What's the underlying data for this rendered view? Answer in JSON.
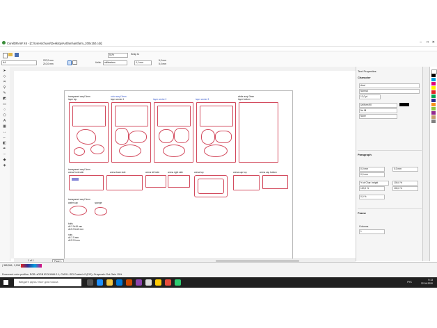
{
  "window": {
    "title": "CorelDRAW X6 - [C:\\Users\\chuvs\\Desktop\\Antfarm\\antfarm_200x150.cdr]"
  },
  "toolbar": {
    "zoom": "51%",
    "snap_to": "Snap to"
  },
  "propertybar": {
    "page_size": "A4",
    "width": "297,0 mm",
    "height": "210,0 mm",
    "units_label": "Units:",
    "units": "millimeters",
    "nudge": "0,1 mm",
    "dup_x": "5,0 mm",
    "dup_y": "5,0 mm"
  },
  "document": {
    "sheet1": {
      "label": "transparent acryl 3mm",
      "sub": "layer top"
    },
    "sheet2": {
      "label": "color acryl 3mm",
      "sub": "layer center 1"
    },
    "sheet3": {
      "label": "layer center 2"
    },
    "sheet4": {
      "label": "layer center 3"
    },
    "sheet5": {
      "label": "white acryl 3mm",
      "sub": "layer bottom"
    },
    "row2": {
      "label": "transparent acryl 3mm",
      "arena_front": "arena front side",
      "arena_back": "arena back side",
      "arena_left": "arena left side",
      "arena_right": "arena right side",
      "arena_top": "arena top",
      "arena_cap_top": "arena cap top",
      "arena_cap_bottom": "arena cap bottom"
    },
    "row3": {
      "label": "transparent acryl 3mm",
      "water_cap": "water cap",
      "sponge": "sponge"
    },
    "bolts": {
      "title": "bolts",
      "l1": "d4        2.5x16 mm",
      "l2": "d12       2.5x10 mm"
    },
    "nuts": {
      "title": "nuts",
      "l1": "d4        2.5 mm",
      "l2": "d12       2.5 mm"
    }
  },
  "pagenav": {
    "counter": "1 of 1",
    "tab": "Page 1"
  },
  "docker": {
    "title": "Text Properties",
    "character": "Character",
    "font": "Arial",
    "style": "Normal",
    "size": "12,0 pt",
    "fill": "Uniform fill",
    "bg_fill": "No fill",
    "outline": "None",
    "paragraph": "Paragraph",
    "p1": "0,0 mm",
    "p2": "0,0 mm",
    "p3": "0,0 mm",
    "line_spacing_mode": "% of Char. height",
    "line_spacing": "100,0 %",
    "char_spacing": "100,0 %",
    "word_spacing": "100,0 %",
    "lang_spacing": "0,0 %",
    "frame": "Frame",
    "columns_label": "Columns",
    "columns": "1"
  },
  "status": {
    "coords": "( 385,286 ; 3,538 )",
    "profile": "Document color profiles: RGB: sRGB IEC61966-2.1; CMYK: ISO Coated v2 (ECI); Grayscale: Dot Gain 15%"
  },
  "taskbar": {
    "search": "Введите здесь текст для поиска",
    "time": "9:13",
    "date": "22.04.2020",
    "lang": "РУС"
  },
  "colors": {
    "cut_line": "#d34b5e",
    "label_blue": "#3355cc",
    "taskbar": "#202020"
  }
}
